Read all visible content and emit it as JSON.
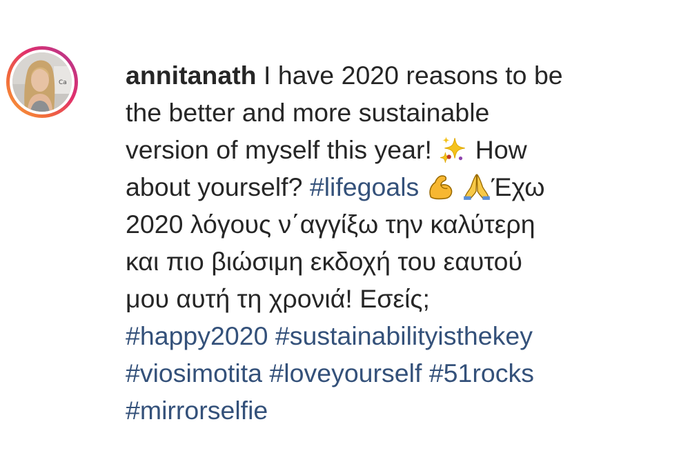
{
  "post": {
    "username": "annitanath",
    "caption": {
      "line1": " I have 2020 reasons to be",
      "line2": "the better and more sustainable",
      "line3_a": "version of myself this year! ",
      "line3_b": " How",
      "line4_a": "about yourself? ",
      "line4_b": " ",
      "line4_c": "Έχω",
      "line5": "2020 λόγους ν΄αγγίξω την καλύτερη",
      "line6": "και πιο βιώσιμη εκδοχή του εαυτού",
      "line7": "μου αυτή τη χρονιά! Εσείς;",
      "space": " "
    },
    "hashtags": {
      "lifegoals": "#lifegoals",
      "happy2020": "#happy2020",
      "sustainabilityisthekey": "#sustainabilityisthekey",
      "viosimotita": "#viosimotita",
      "loveyourself": "#loveyourself",
      "rocks51": "#51rocks",
      "mirrorselfie": "#mirrorselfie"
    },
    "emojis": [
      "sparkles-icon",
      "flexed-biceps-icon",
      "folded-hands-icon"
    ],
    "colors": {
      "text": "#262626",
      "hashtag": "#34517a",
      "story_ring": [
        "#f9a33a",
        "#e1306c",
        "#833ab4"
      ]
    }
  }
}
